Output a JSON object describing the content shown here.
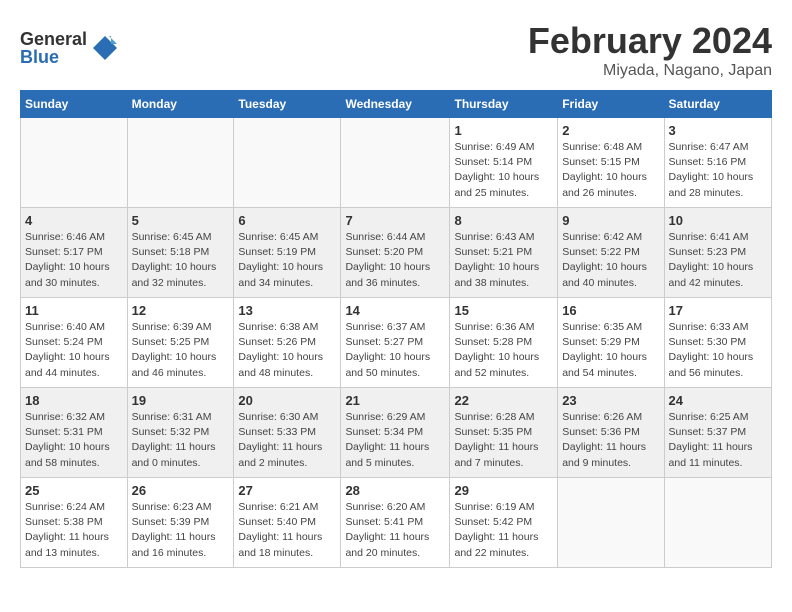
{
  "logo": {
    "general": "General",
    "blue": "Blue"
  },
  "title": {
    "month": "February 2024",
    "location": "Miyada, Nagano, Japan"
  },
  "weekdays": [
    "Sunday",
    "Monday",
    "Tuesday",
    "Wednesday",
    "Thursday",
    "Friday",
    "Saturday"
  ],
  "weeks": [
    [
      {
        "day": "",
        "info": ""
      },
      {
        "day": "",
        "info": ""
      },
      {
        "day": "",
        "info": ""
      },
      {
        "day": "",
        "info": ""
      },
      {
        "day": "1",
        "info": "Sunrise: 6:49 AM\nSunset: 5:14 PM\nDaylight: 10 hours\nand 25 minutes."
      },
      {
        "day": "2",
        "info": "Sunrise: 6:48 AM\nSunset: 5:15 PM\nDaylight: 10 hours\nand 26 minutes."
      },
      {
        "day": "3",
        "info": "Sunrise: 6:47 AM\nSunset: 5:16 PM\nDaylight: 10 hours\nand 28 minutes."
      }
    ],
    [
      {
        "day": "4",
        "info": "Sunrise: 6:46 AM\nSunset: 5:17 PM\nDaylight: 10 hours\nand 30 minutes."
      },
      {
        "day": "5",
        "info": "Sunrise: 6:45 AM\nSunset: 5:18 PM\nDaylight: 10 hours\nand 32 minutes."
      },
      {
        "day": "6",
        "info": "Sunrise: 6:45 AM\nSunset: 5:19 PM\nDaylight: 10 hours\nand 34 minutes."
      },
      {
        "day": "7",
        "info": "Sunrise: 6:44 AM\nSunset: 5:20 PM\nDaylight: 10 hours\nand 36 minutes."
      },
      {
        "day": "8",
        "info": "Sunrise: 6:43 AM\nSunset: 5:21 PM\nDaylight: 10 hours\nand 38 minutes."
      },
      {
        "day": "9",
        "info": "Sunrise: 6:42 AM\nSunset: 5:22 PM\nDaylight: 10 hours\nand 40 minutes."
      },
      {
        "day": "10",
        "info": "Sunrise: 6:41 AM\nSunset: 5:23 PM\nDaylight: 10 hours\nand 42 minutes."
      }
    ],
    [
      {
        "day": "11",
        "info": "Sunrise: 6:40 AM\nSunset: 5:24 PM\nDaylight: 10 hours\nand 44 minutes."
      },
      {
        "day": "12",
        "info": "Sunrise: 6:39 AM\nSunset: 5:25 PM\nDaylight: 10 hours\nand 46 minutes."
      },
      {
        "day": "13",
        "info": "Sunrise: 6:38 AM\nSunset: 5:26 PM\nDaylight: 10 hours\nand 48 minutes."
      },
      {
        "day": "14",
        "info": "Sunrise: 6:37 AM\nSunset: 5:27 PM\nDaylight: 10 hours\nand 50 minutes."
      },
      {
        "day": "15",
        "info": "Sunrise: 6:36 AM\nSunset: 5:28 PM\nDaylight: 10 hours\nand 52 minutes."
      },
      {
        "day": "16",
        "info": "Sunrise: 6:35 AM\nSunset: 5:29 PM\nDaylight: 10 hours\nand 54 minutes."
      },
      {
        "day": "17",
        "info": "Sunrise: 6:33 AM\nSunset: 5:30 PM\nDaylight: 10 hours\nand 56 minutes."
      }
    ],
    [
      {
        "day": "18",
        "info": "Sunrise: 6:32 AM\nSunset: 5:31 PM\nDaylight: 10 hours\nand 58 minutes."
      },
      {
        "day": "19",
        "info": "Sunrise: 6:31 AM\nSunset: 5:32 PM\nDaylight: 11 hours\nand 0 minutes."
      },
      {
        "day": "20",
        "info": "Sunrise: 6:30 AM\nSunset: 5:33 PM\nDaylight: 11 hours\nand 2 minutes."
      },
      {
        "day": "21",
        "info": "Sunrise: 6:29 AM\nSunset: 5:34 PM\nDaylight: 11 hours\nand 5 minutes."
      },
      {
        "day": "22",
        "info": "Sunrise: 6:28 AM\nSunset: 5:35 PM\nDaylight: 11 hours\nand 7 minutes."
      },
      {
        "day": "23",
        "info": "Sunrise: 6:26 AM\nSunset: 5:36 PM\nDaylight: 11 hours\nand 9 minutes."
      },
      {
        "day": "24",
        "info": "Sunrise: 6:25 AM\nSunset: 5:37 PM\nDaylight: 11 hours\nand 11 minutes."
      }
    ],
    [
      {
        "day": "25",
        "info": "Sunrise: 6:24 AM\nSunset: 5:38 PM\nDaylight: 11 hours\nand 13 minutes."
      },
      {
        "day": "26",
        "info": "Sunrise: 6:23 AM\nSunset: 5:39 PM\nDaylight: 11 hours\nand 16 minutes."
      },
      {
        "day": "27",
        "info": "Sunrise: 6:21 AM\nSunset: 5:40 PM\nDaylight: 11 hours\nand 18 minutes."
      },
      {
        "day": "28",
        "info": "Sunrise: 6:20 AM\nSunset: 5:41 PM\nDaylight: 11 hours\nand 20 minutes."
      },
      {
        "day": "29",
        "info": "Sunrise: 6:19 AM\nSunset: 5:42 PM\nDaylight: 11 hours\nand 22 minutes."
      },
      {
        "day": "",
        "info": ""
      },
      {
        "day": "",
        "info": ""
      }
    ]
  ]
}
